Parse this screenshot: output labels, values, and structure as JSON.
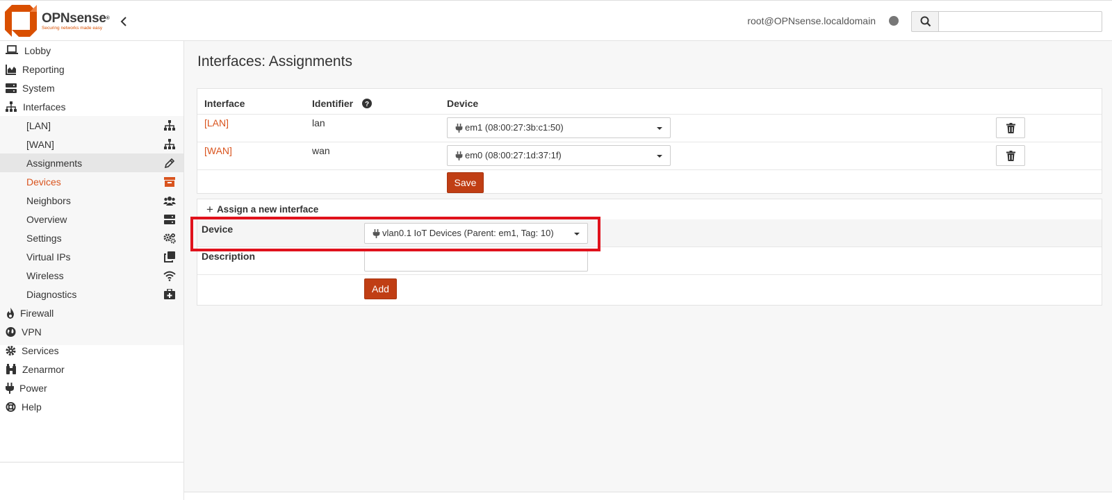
{
  "header": {
    "brand_name": "OPNsense",
    "brand_reg": "®",
    "brand_tagline": "Securing networks made easy",
    "user": "root@OPNsense.localdomain",
    "search_placeholder": ""
  },
  "sidebar": {
    "items": [
      {
        "label": "Lobby",
        "icon": "laptop-icon"
      },
      {
        "label": "Reporting",
        "icon": "area-chart-icon"
      },
      {
        "label": "System",
        "icon": "server-icon"
      },
      {
        "label": "Interfaces",
        "icon": "sitemap-icon"
      }
    ],
    "interfaces_sub": [
      {
        "label": "[LAN]",
        "icon": "sitemap-icon"
      },
      {
        "label": "[WAN]",
        "icon": "sitemap-icon"
      },
      {
        "label": "Assignments",
        "icon": "pencil-icon"
      },
      {
        "label": "Devices",
        "icon": "archive-icon"
      },
      {
        "label": "Neighbors",
        "icon": "users-icon"
      },
      {
        "label": "Overview",
        "icon": "server-icon"
      },
      {
        "label": "Settings",
        "icon": "cogs-icon"
      },
      {
        "label": "Virtual IPs",
        "icon": "clone-icon"
      },
      {
        "label": "Wireless",
        "icon": "wifi-icon"
      },
      {
        "label": "Diagnostics",
        "icon": "medkit-icon"
      }
    ],
    "items_after": [
      {
        "label": "Firewall",
        "icon": "fire-icon"
      },
      {
        "label": "VPN",
        "icon": "globe-icon"
      },
      {
        "label": "Services",
        "icon": "cog-icon"
      },
      {
        "label": "Zenarmor",
        "icon": "binoculars-icon"
      },
      {
        "label": "Power",
        "icon": "plug-icon"
      },
      {
        "label": "Help",
        "icon": "life-ring-icon"
      }
    ]
  },
  "main": {
    "title": "Interfaces: Assignments",
    "table": {
      "headers": [
        "Interface",
        "Identifier",
        "Device"
      ],
      "rows": [
        {
          "interface": "[LAN]",
          "identifier": "lan",
          "device": "em1 (08:00:27:3b:c1:50)"
        },
        {
          "interface": "[WAN]",
          "identifier": "wan",
          "device": "em0 (08:00:27:1d:37:1f)"
        }
      ],
      "save_label": "Save"
    },
    "assign": {
      "header": "Assign a new interface",
      "plus": "+",
      "device_label": "Device",
      "device_value": "vlan0.1 IoT Devices (Parent: em1, Tag: 10)",
      "description_label": "Description",
      "description_value": "",
      "add_label": "Add"
    }
  },
  "colors": {
    "accent": "#d9541e",
    "button": "#c03e14",
    "highlight": "#e0121c"
  }
}
